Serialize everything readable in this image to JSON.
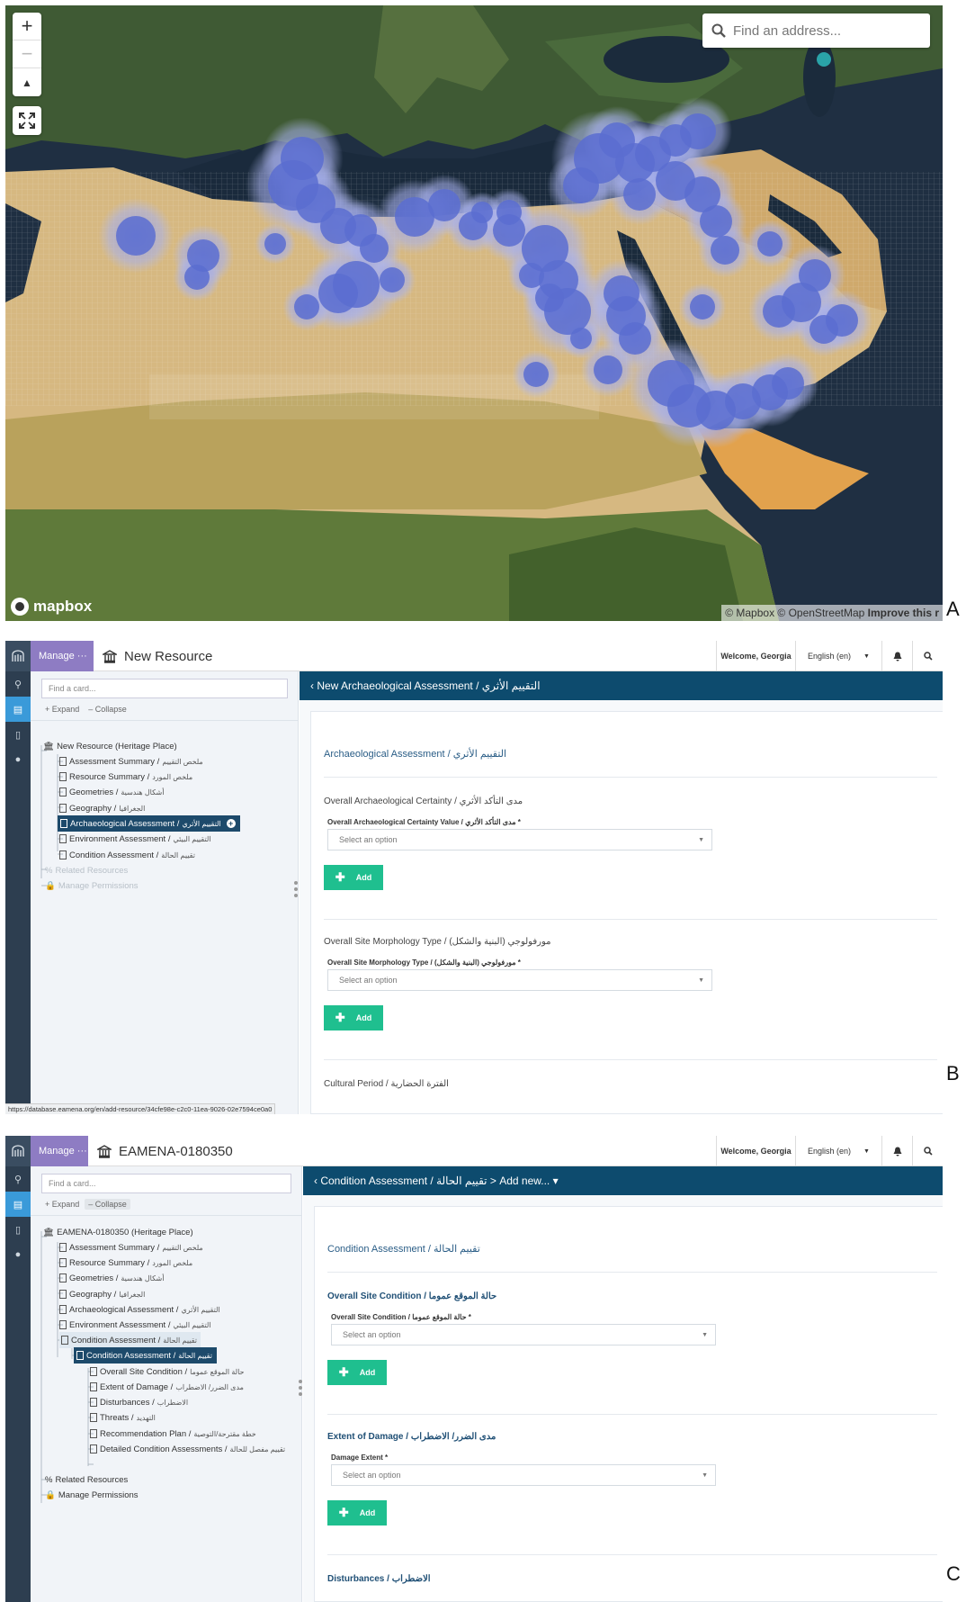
{
  "panel_labels": {
    "a": "A",
    "b": "B",
    "c": "C"
  },
  "map": {
    "zoom_in": "+",
    "zoom_out": "−",
    "compass": "▲",
    "search_placeholder": "Find an address...",
    "logo_text": "mapbox",
    "attribution": "© Mapbox © OpenStreetMap",
    "improve": "Improve this r",
    "cluster_color": "#5a6dd0"
  },
  "panel_b": {
    "manage_label": "Manage ···",
    "resource_title": "New Resource",
    "welcome": "Welcome, Georgia",
    "language": "English (en)",
    "find_card_placeholder": "Find a card...",
    "expand": "+ Expand",
    "collapse": "– Collapse",
    "tree": [
      {
        "label": "New Resource (Heritage Place)",
        "ar": ""
      },
      {
        "label": "Assessment Summary /",
        "ar": "ملخص التقييم"
      },
      {
        "label": "Resource Summary /",
        "ar": "ملخص المورد"
      },
      {
        "label": "Geometries /",
        "ar": "أشكال هندسية"
      },
      {
        "label": "Geography /",
        "ar": "الجغرافيا"
      },
      {
        "label": "Archaeological Assessment /",
        "ar": "التقييم الأثري"
      },
      {
        "label": "Environment Assessment /",
        "ar": "التقييم البيئي"
      },
      {
        "label": "Condition Assessment /",
        "ar": "تقييم الحالة"
      },
      {
        "label": "Related Resources",
        "ar": ""
      },
      {
        "label": "Manage Permissions",
        "ar": ""
      }
    ],
    "header": "‹ New Archaeological Assessment / التقييم الأثري",
    "card_title": "Archaeological Assessment / التقييم الأثري",
    "sections": [
      {
        "title": "Overall Archaeological Certainty / مدى التأكد الأثري",
        "field": "Overall Archaeological Certainty Value / مدى التأكد الأثري *",
        "placeholder": "Select an option",
        "add": "Add"
      },
      {
        "title": "Overall Site Morphology Type / مورفولوجي (البنية والشكل)",
        "field": "Overall Site Morphology Type / مورفولوجي (البنية والشكل) *",
        "placeholder": "Select an option",
        "add": "Add"
      },
      {
        "title": "Cultural Period / الفترة الحضارية"
      }
    ],
    "status_url": "https://database.eamena.org/en/add-resource/34cfe98e-c2c0-11ea-9026-02e7594ce0a0"
  },
  "panel_c": {
    "manage_label": "Manage ···",
    "resource_title": "EAMENA-0180350",
    "welcome": "Welcome, Georgia",
    "language": "English (en)",
    "find_card_placeholder": "Find a card...",
    "expand": "+ Expand",
    "collapse": "– Collapse",
    "tree": [
      {
        "label": "EAMENA-0180350 (Heritage Place)",
        "ar": ""
      },
      {
        "label": "Assessment Summary /",
        "ar": "ملخص التقييم"
      },
      {
        "label": "Resource Summary /",
        "ar": "ملخص المورد"
      },
      {
        "label": "Geometries /",
        "ar": "أشكال هندسية"
      },
      {
        "label": "Geography /",
        "ar": "الجغرافيا"
      },
      {
        "label": "Archaeological Assessment /",
        "ar": "التقييم الأثري"
      },
      {
        "label": "Environment Assessment /",
        "ar": "التقييم البيئي"
      },
      {
        "label": "Condition Assessment /",
        "ar": "تقييم الحالة"
      },
      {
        "label": "Condition Assessment /",
        "ar": "تقييم الحالة"
      },
      {
        "label": "Overall Site Condition /",
        "ar": "حالة الموقع عموما"
      },
      {
        "label": "Extent of Damage /",
        "ar": "مدى الضرر/ الاضطراب"
      },
      {
        "label": "Disturbances /",
        "ar": "الاضطراب"
      },
      {
        "label": "Threats /",
        "ar": "التهديد"
      },
      {
        "label": "Recommendation Plan /",
        "ar": "خطة مقترحة/التوصية"
      },
      {
        "label": "Detailed Condition Assessments /",
        "ar": "تقييم مفصل للحالة"
      },
      {
        "label": "Related Resources",
        "ar": ""
      },
      {
        "label": "Manage Permissions",
        "ar": ""
      }
    ],
    "header": "‹ Condition Assessment / تقييم الحالة > Add new... ▾",
    "card_title": "Condition Assessment / تقييم الحالة",
    "sections": [
      {
        "title": "Overall Site Condition / حالة الموقع عموما",
        "field": "Overall Site Condition / حالة الموقع عموما *",
        "placeholder": "Select an option",
        "add": "Add"
      },
      {
        "title": "Extent of Damage / مدى الضرر/ الاضطراب",
        "field": "Damage Extent *",
        "placeholder": "Select an option",
        "add": "Add"
      },
      {
        "title": "Disturbances / الاضطراب"
      }
    ]
  }
}
